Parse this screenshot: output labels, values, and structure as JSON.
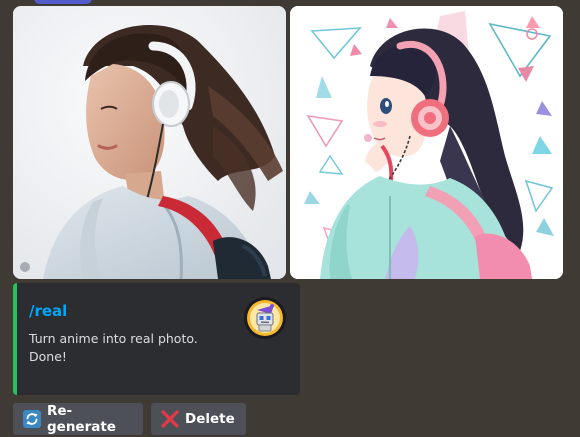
{
  "images": [
    {
      "name": "realistic-photo",
      "description_icon": "photo"
    },
    {
      "name": "anime-illustration",
      "description_icon": "photo"
    }
  ],
  "embed": {
    "title": "/real",
    "description_line1": "Turn anime into real photo.",
    "description_line2": "Done!",
    "accent_color": "#23c45e",
    "title_color": "#00a8fc",
    "thumbnail_icon": "bot-avatar-icon"
  },
  "actions": {
    "regenerate_label": "Re-generate",
    "regenerate_icon": "refresh-icon",
    "delete_label": "Delete",
    "delete_icon": "cross-icon"
  }
}
